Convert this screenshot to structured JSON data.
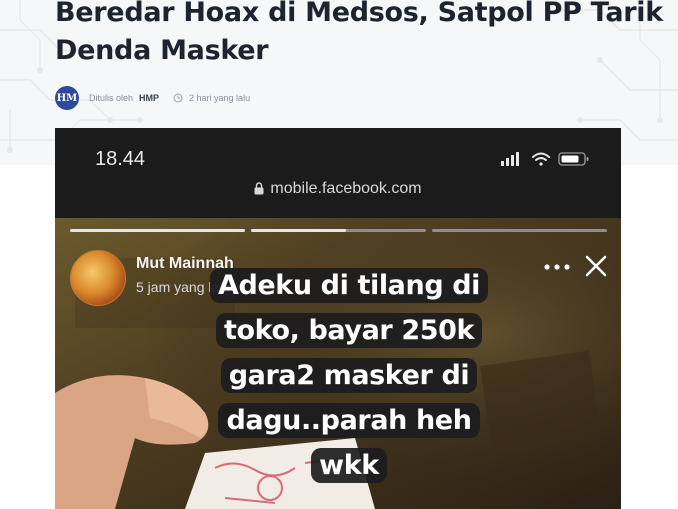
{
  "article": {
    "title": "Beredar Hoax di Medsos, Satpol PP Tarik Denda Masker",
    "author_initials": "HM",
    "written_by_label": "Ditulis oleh",
    "author": "HMP",
    "published": "2 hari yang lalu"
  },
  "screenshot": {
    "time": "18.44",
    "url": "mobile.facebook.com",
    "story": {
      "name": "Mut Mainnah",
      "time": "5 jam yang lalu",
      "caption": "Adeku di tilang di toko, bayar 250k gara2 masker di dagu..parah heh wkk"
    }
  },
  "colors": {
    "title": "#1e2330",
    "avatar_bg": "#2f4a9c",
    "meta_text": "#8a8f99"
  },
  "icons": [
    "clock-icon",
    "signal-icon",
    "wifi-icon",
    "battery-icon",
    "lock-icon",
    "more-dots-icon",
    "close-icon"
  ]
}
